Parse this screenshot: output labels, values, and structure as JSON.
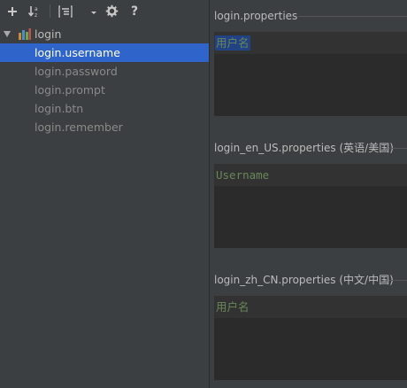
{
  "toolbar": {
    "add_icon": "plus-icon",
    "sort_icon": "sort-alpha-icon",
    "group_icon": "group-by-icon",
    "dropdown_icon": "chevron-down-icon",
    "settings_icon": "gear-icon",
    "help_glyph": "?"
  },
  "tree": {
    "root_label": "login",
    "items": [
      {
        "label": "login.username",
        "selected": true
      },
      {
        "label": "login.password",
        "selected": false
      },
      {
        "label": "login.prompt",
        "selected": false
      },
      {
        "label": "login.btn",
        "selected": false
      },
      {
        "label": "login.remember",
        "selected": false
      }
    ]
  },
  "editors": [
    {
      "file": "login.properties",
      "value": "用户名"
    },
    {
      "file": "login_en_US.properties (英语/美国)",
      "value": "Username"
    },
    {
      "file": "login_zh_CN.properties (中文/中国)",
      "value": "用户名"
    }
  ],
  "colors": {
    "background": "#3c3f41",
    "editor_bg": "#2b2b2b",
    "selection": "#2f65ca",
    "string_value": "#6a8759"
  }
}
